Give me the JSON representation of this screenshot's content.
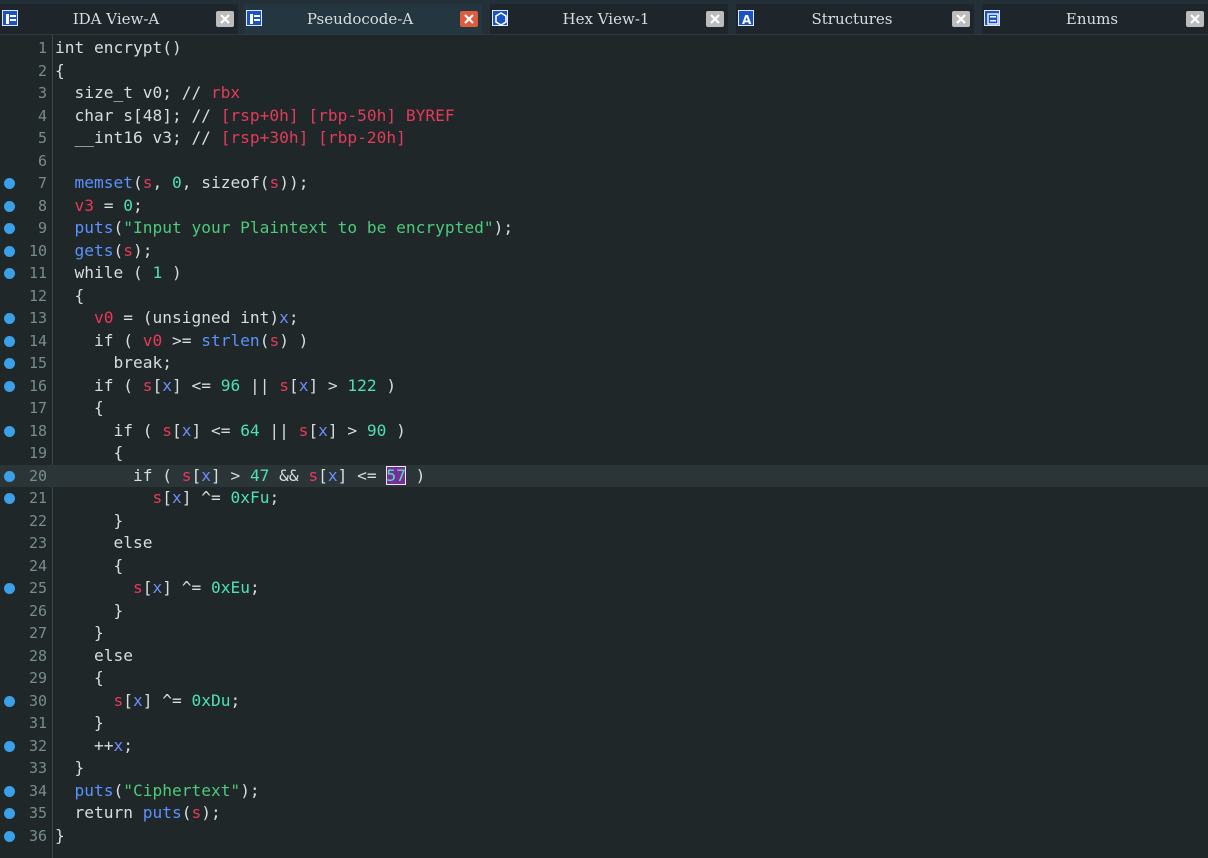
{
  "tabs": [
    {
      "label": "IDA View-A",
      "active": false,
      "icon": "disassembly-icon"
    },
    {
      "label": "Pseudocode-A",
      "active": true,
      "icon": "pseudocode-icon"
    },
    {
      "label": "Hex View-1",
      "active": false,
      "icon": "hex-icon"
    },
    {
      "label": "Structures",
      "active": false,
      "icon": "structures-icon"
    },
    {
      "label": "Enums",
      "active": false,
      "icon": "enums-icon"
    }
  ],
  "colors": {
    "background": "#1f2729",
    "local_var": "#e8385a",
    "number": "#4ee0b4",
    "string": "#4ec97a",
    "function": "#5a92ff",
    "global": "#6c8dff",
    "breakpoint": "#3aa0e8",
    "close_active": "#e05a3c"
  },
  "current_line": 20,
  "lines": [
    {
      "n": "1",
      "bp": false,
      "t": [
        [
          "int encrypt()",
          ""
        ]
      ]
    },
    {
      "n": "2",
      "bp": false,
      "t": [
        [
          "{",
          ""
        ]
      ]
    },
    {
      "n": "3",
      "bp": false,
      "t": [
        [
          "  size_t v0; // ",
          ""
        ],
        [
          "rbx",
          "cmt"
        ]
      ]
    },
    {
      "n": "4",
      "bp": false,
      "t": [
        [
          "  char s[48]; // ",
          ""
        ],
        [
          "[rsp+0h] [rbp-50h] BYREF",
          "cmt"
        ]
      ]
    },
    {
      "n": "5",
      "bp": false,
      "t": [
        [
          "  __int16 v3; // ",
          ""
        ],
        [
          "[rsp+30h] [rbp-20h]",
          "cmt"
        ]
      ]
    },
    {
      "n": "6",
      "bp": false,
      "t": []
    },
    {
      "n": "7",
      "bp": true,
      "t": [
        [
          "  ",
          ""
        ],
        [
          "memset",
          "func"
        ],
        [
          "(",
          ""
        ],
        [
          "s",
          "var"
        ],
        [
          ", ",
          ""
        ],
        [
          "0",
          "num"
        ],
        [
          ", sizeof(",
          ""
        ],
        [
          "s",
          "var"
        ],
        [
          "));",
          ""
        ]
      ]
    },
    {
      "n": "8",
      "bp": true,
      "t": [
        [
          "  ",
          ""
        ],
        [
          "v3",
          "var"
        ],
        [
          " = ",
          ""
        ],
        [
          "0",
          "num"
        ],
        [
          ";",
          ""
        ]
      ]
    },
    {
      "n": "9",
      "bp": true,
      "t": [
        [
          "  ",
          ""
        ],
        [
          "puts",
          "func"
        ],
        [
          "(",
          ""
        ],
        [
          "\"Input your Plaintext to be encrypted\"",
          "str"
        ],
        [
          ");",
          ""
        ]
      ]
    },
    {
      "n": "10",
      "bp": true,
      "t": [
        [
          "  ",
          ""
        ],
        [
          "gets",
          "func"
        ],
        [
          "(",
          ""
        ],
        [
          "s",
          "var"
        ],
        [
          ");",
          ""
        ]
      ]
    },
    {
      "n": "11",
      "bp": true,
      "t": [
        [
          "  while ( ",
          ""
        ],
        [
          "1",
          "num"
        ],
        [
          " )",
          ""
        ]
      ]
    },
    {
      "n": "12",
      "bp": false,
      "t": [
        [
          "  {",
          ""
        ]
      ]
    },
    {
      "n": "13",
      "bp": true,
      "t": [
        [
          "    ",
          ""
        ],
        [
          "v0",
          "var"
        ],
        [
          " = (unsigned int)",
          ""
        ],
        [
          "x",
          "glob"
        ],
        [
          ";",
          ""
        ]
      ]
    },
    {
      "n": "14",
      "bp": true,
      "t": [
        [
          "    if ( ",
          ""
        ],
        [
          "v0",
          "var"
        ],
        [
          " >= ",
          ""
        ],
        [
          "strlen",
          "func"
        ],
        [
          "(",
          ""
        ],
        [
          "s",
          "var"
        ],
        [
          ") )",
          ""
        ]
      ]
    },
    {
      "n": "15",
      "bp": true,
      "t": [
        [
          "      break;",
          ""
        ]
      ]
    },
    {
      "n": "16",
      "bp": true,
      "t": [
        [
          "    if ( ",
          ""
        ],
        [
          "s",
          "var"
        ],
        [
          "[",
          ""
        ],
        [
          "x",
          "glob"
        ],
        [
          "] <= ",
          ""
        ],
        [
          "96",
          "num"
        ],
        [
          " || ",
          ""
        ],
        [
          "s",
          "var"
        ],
        [
          "[",
          ""
        ],
        [
          "x",
          "glob"
        ],
        [
          "] > ",
          ""
        ],
        [
          "122",
          "num"
        ],
        [
          " )",
          ""
        ]
      ]
    },
    {
      "n": "17",
      "bp": false,
      "t": [
        [
          "    {",
          ""
        ]
      ]
    },
    {
      "n": "18",
      "bp": true,
      "t": [
        [
          "      if ( ",
          ""
        ],
        [
          "s",
          "var"
        ],
        [
          "[",
          ""
        ],
        [
          "x",
          "glob"
        ],
        [
          "] <= ",
          ""
        ],
        [
          "64",
          "num"
        ],
        [
          " || ",
          ""
        ],
        [
          "s",
          "var"
        ],
        [
          "[",
          ""
        ],
        [
          "x",
          "glob"
        ],
        [
          "] > ",
          ""
        ],
        [
          "90",
          "num"
        ],
        [
          " )",
          ""
        ]
      ]
    },
    {
      "n": "19",
      "bp": false,
      "t": [
        [
          "      {",
          ""
        ]
      ]
    },
    {
      "n": "20",
      "bp": true,
      "t": [
        [
          "        if ( ",
          ""
        ],
        [
          "s",
          "var"
        ],
        [
          "[",
          ""
        ],
        [
          "x",
          "glob"
        ],
        [
          "] > ",
          ""
        ],
        [
          "47",
          "num"
        ],
        [
          " && ",
          ""
        ],
        [
          "s",
          "var"
        ],
        [
          "[",
          ""
        ],
        [
          "x",
          "glob"
        ],
        [
          "] <= ",
          ""
        ],
        [
          "57",
          "sel"
        ],
        [
          " )",
          ""
        ]
      ]
    },
    {
      "n": "21",
      "bp": true,
      "t": [
        [
          "          ",
          ""
        ],
        [
          "s",
          "var"
        ],
        [
          "[",
          ""
        ],
        [
          "x",
          "glob"
        ],
        [
          "] ^= ",
          ""
        ],
        [
          "0xFu",
          "num"
        ],
        [
          ";",
          ""
        ]
      ]
    },
    {
      "n": "22",
      "bp": false,
      "t": [
        [
          "      }",
          ""
        ]
      ]
    },
    {
      "n": "23",
      "bp": false,
      "t": [
        [
          "      else",
          ""
        ]
      ]
    },
    {
      "n": "24",
      "bp": false,
      "t": [
        [
          "      {",
          ""
        ]
      ]
    },
    {
      "n": "25",
      "bp": true,
      "t": [
        [
          "        ",
          ""
        ],
        [
          "s",
          "var"
        ],
        [
          "[",
          ""
        ],
        [
          "x",
          "glob"
        ],
        [
          "] ^= ",
          ""
        ],
        [
          "0xEu",
          "num"
        ],
        [
          ";",
          ""
        ]
      ]
    },
    {
      "n": "26",
      "bp": false,
      "t": [
        [
          "      }",
          ""
        ]
      ]
    },
    {
      "n": "27",
      "bp": false,
      "t": [
        [
          "    }",
          ""
        ]
      ]
    },
    {
      "n": "28",
      "bp": false,
      "t": [
        [
          "    else",
          ""
        ]
      ]
    },
    {
      "n": "29",
      "bp": false,
      "t": [
        [
          "    {",
          ""
        ]
      ]
    },
    {
      "n": "30",
      "bp": true,
      "t": [
        [
          "      ",
          ""
        ],
        [
          "s",
          "var"
        ],
        [
          "[",
          ""
        ],
        [
          "x",
          "glob"
        ],
        [
          "] ^= ",
          ""
        ],
        [
          "0xDu",
          "num"
        ],
        [
          ";",
          ""
        ]
      ]
    },
    {
      "n": "31",
      "bp": false,
      "t": [
        [
          "    }",
          ""
        ]
      ]
    },
    {
      "n": "32",
      "bp": true,
      "t": [
        [
          "    ++",
          ""
        ],
        [
          "x",
          "glob"
        ],
        [
          ";",
          ""
        ]
      ]
    },
    {
      "n": "33",
      "bp": false,
      "t": [
        [
          "  }",
          ""
        ]
      ]
    },
    {
      "n": "34",
      "bp": true,
      "t": [
        [
          "  ",
          ""
        ],
        [
          "puts",
          "func"
        ],
        [
          "(",
          ""
        ],
        [
          "\"Ciphertext\"",
          "str"
        ],
        [
          ");",
          ""
        ]
      ]
    },
    {
      "n": "35",
      "bp": true,
      "t": [
        [
          "  return ",
          ""
        ],
        [
          "puts",
          "func"
        ],
        [
          "(",
          ""
        ],
        [
          "s",
          "var"
        ],
        [
          ");",
          ""
        ]
      ]
    },
    {
      "n": "36",
      "bp": true,
      "t": [
        [
          "}",
          ""
        ]
      ]
    }
  ]
}
